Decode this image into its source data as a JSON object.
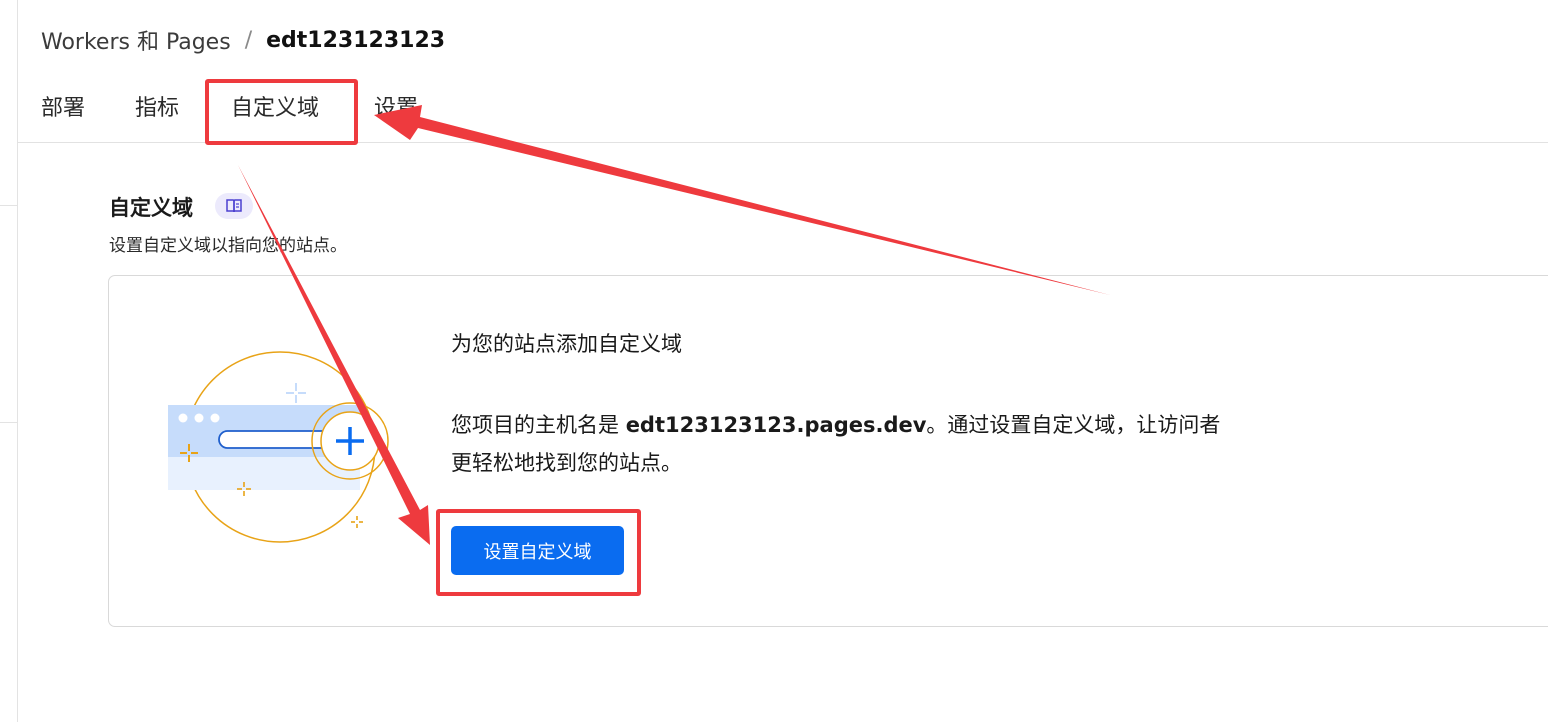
{
  "breadcrumb": {
    "root": "Workers 和 Pages",
    "separator": "/",
    "current": "edt123123123"
  },
  "tabs": [
    {
      "label": "部署"
    },
    {
      "label": "指标"
    },
    {
      "label": "自定义域",
      "active": true
    },
    {
      "label": "设置"
    }
  ],
  "section": {
    "title": "自定义域",
    "docs_icon": "book-icon",
    "description": "设置自定义域以指向您的站点。"
  },
  "card": {
    "heading": "为您的站点添加自定义域",
    "body_prefix": "您项目的主机名是 ",
    "hostname": "edt123123123.pages.dev",
    "body_suffix": "。通过设置自定义域，让访问者更轻松地找到您的站点。",
    "button_label": "设置自定义域",
    "illustration_icon": "browser-add-domain-illustration"
  },
  "colors": {
    "primary": "#0a6cf0",
    "annotation": "#ee3a3e",
    "illustration_orange": "#e8a317",
    "illustration_blue": "#c6dcfb"
  }
}
